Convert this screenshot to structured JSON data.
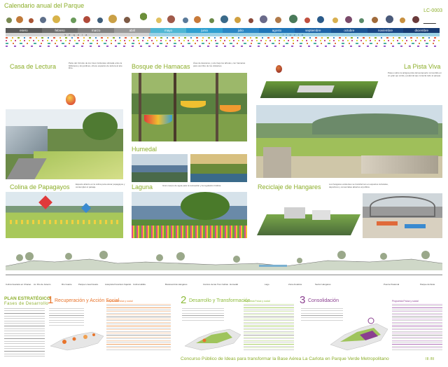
{
  "sheet_code": "LC-0003",
  "calendar": {
    "title": "Calendario anual del Parque",
    "months": [
      "enero",
      "febrero",
      "marzo",
      "abril",
      "mayo",
      "junio",
      "julio",
      "agosto",
      "septiembre",
      "octubre",
      "noviembre",
      "diciembre"
    ],
    "seasons": [
      {
        "label": "sequía"
      },
      {
        "label": "lluvia"
      }
    ],
    "month_colors": [
      "#5a5a5a",
      "#6d6d6d",
      "#818181",
      "#9a9a9a",
      "#4fb6d3",
      "#2f9fd0",
      "#2a86c4",
      "#1f74b8",
      "#1d63a7",
      "#1b5594",
      "#194684",
      "#163a72"
    ]
  },
  "areas": {
    "casa_lectura": {
      "title": "Casa de Lectura",
      "text": "Parte del Circuito de los Usos Culturales ubicada entre la biblioteca y los jardines, ofrece espacios de lectura al aire libre."
    },
    "bosque_hamacas": {
      "title": "Bosque de Hamacas",
      "text": "Área de descanso y ocio bajo los árboles, con hamacas para uso libre de los visitantes."
    },
    "pista_viva": {
      "title": "La Pista Viva",
      "text": "Paseo sobre la antigua pista del aeropuerto convertido en un gran eje verde y peatonal que conecta todo el parque."
    },
    "humedal": {
      "title": "Humedal"
    },
    "colina_papagayos": {
      "title": "Colina de Papagayos",
      "text": "Espacio abierto en la colina para elevar papagayos y contemplar el paisaje."
    },
    "laguna": {
      "title": "Laguna",
      "text": "Gran cuerpo de agua para la recreación y la regulación hídrica."
    },
    "reciclaje_hangares": {
      "title": "Reciclaje de Hangares",
      "text": "Los hangares existentes se transforman en espacios culturales, deportivos y comerciales abiertos al público."
    }
  },
  "section_labels": [
    "Colina Guaraira en Chacao",
    "Av. Río de Janeiro",
    "Río Guaire",
    "Parque Lineal Guaire",
    "Autopista Francisco Fajardo",
    "Colina Hélida",
    "Boulevard de Hangares",
    "Camino de las Tres Ceibas",
    "Humedal",
    "Lago",
    "Zona Acuática",
    "Sector Hangares",
    "Puente Peatonal",
    "Parque del Este"
  ],
  "plan": {
    "title": "PLAN ESTRATÉGICO",
    "subtitle": "Fases de Desarrollo",
    "phases": [
      {
        "number": "1",
        "title": "Recuperación y Acción Social",
        "header": "Propuesta Física y social"
      },
      {
        "number": "2",
        "title": "Desarrollo y Transformación",
        "header": "Propuesta Física y social"
      },
      {
        "number": "3",
        "title": "Consolidación",
        "header": "Propuesta Física y social"
      }
    ]
  },
  "footer": {
    "title": "Concurso Público de Ideas para transformar la Base Aérea La Carlota en Parque Verde Metropolitano",
    "page": "III /III"
  },
  "colors": {
    "accent_green": "#8cae2a",
    "phase_orange": "#e8742b",
    "phase_green": "#8dbb3a",
    "phase_purple": "#8a3e8f"
  }
}
